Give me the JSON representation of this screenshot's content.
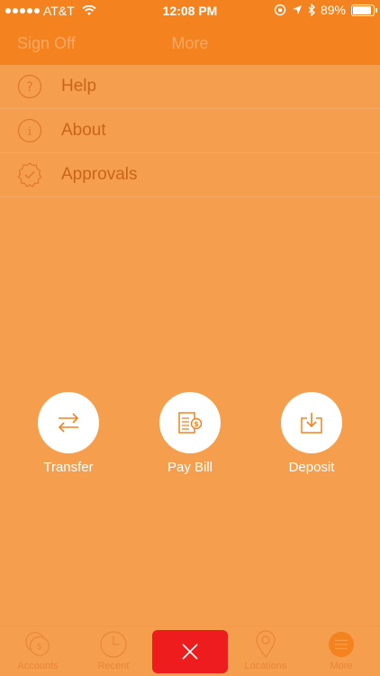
{
  "status_bar": {
    "carrier": "AT&T",
    "time": "12:08 PM",
    "battery": "89%",
    "battery_level": 0.89
  },
  "nav": {
    "sign_off": "Sign Off",
    "title": "More"
  },
  "menu": {
    "items": [
      {
        "label": "Help",
        "icon": "question-icon"
      },
      {
        "label": "About",
        "icon": "info-icon"
      },
      {
        "label": "Approvals",
        "icon": "check-badge-icon"
      }
    ]
  },
  "actions": [
    {
      "label": "Transfer",
      "icon": "transfer-arrows-icon"
    },
    {
      "label": "Pay Bill",
      "icon": "pay-bill-icon"
    },
    {
      "label": "Deposit",
      "icon": "deposit-tray-icon"
    }
  ],
  "tabs": [
    {
      "label": "Accounts",
      "icon": "coins-icon"
    },
    {
      "label": "Recent",
      "icon": "clock-icon"
    },
    {
      "label": "",
      "icon": "close-icon"
    },
    {
      "label": "Locations",
      "icon": "location-pin-icon"
    },
    {
      "label": "More",
      "icon": "menu-lines-icon"
    }
  ],
  "colors": {
    "header": "#f3821f",
    "background": "#f59e4e",
    "accent_dark": "#c9651b",
    "close_button": "#ee1c1c"
  }
}
